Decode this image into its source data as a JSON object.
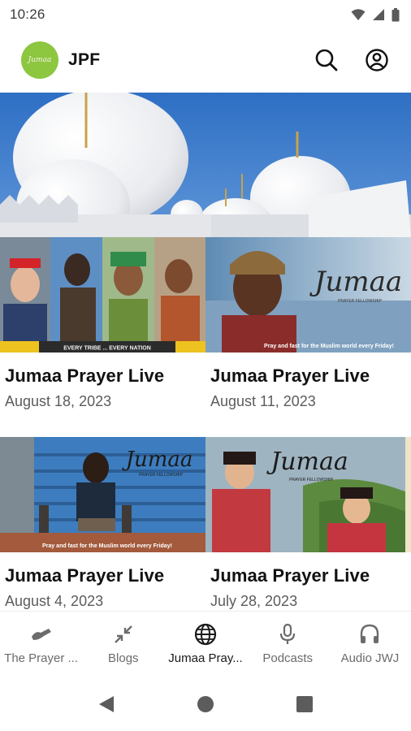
{
  "status_bar": {
    "time": "10:26",
    "icons": [
      "wifi-icon",
      "signal-icon",
      "battery-icon"
    ]
  },
  "app_bar": {
    "logo_text": "Jumaa",
    "title": "JPF",
    "actions": [
      "search-icon",
      "account-icon"
    ],
    "logo_color": "#8dc63f"
  },
  "hero": {
    "image": "mosque-domes-hero"
  },
  "cards": [
    {
      "title": "Jumaa Prayer Live",
      "date": "August 18, 2023",
      "image": "every-tribe-every-nation",
      "caption": "EVERY TRIBE ... EVERY NATION"
    },
    {
      "title": "Jumaa Prayer Live",
      "date": "August 11, 2023",
      "image": "woman-headdress-jumaa",
      "caption": "Pray and fast for the Muslim world every Friday!",
      "overlay": "Jumaa",
      "overlay_sub": "PRAYER FELLOWSHIP"
    },
    {
      "title": "Jumaa Prayer Live",
      "date": "August 4, 2023",
      "image": "boy-blue-wall-jumaa",
      "caption": "Pray and fast for the Muslim world every Friday!",
      "overlay": "Jumaa",
      "overlay_sub": "PRAYER FELLOWSHIP"
    },
    {
      "title": "Jumaa Prayer Live",
      "date": "July 28, 2023",
      "image": "two-women-terraces-jumaa",
      "caption": "",
      "overlay": "Jumaa",
      "overlay_sub": "PRAYER FELLOWSHIP"
    }
  ],
  "bottom_nav": [
    {
      "label": "The Prayer ...",
      "icon": "handshake-icon",
      "active": false
    },
    {
      "label": "Blogs",
      "icon": "arrows-collapse-icon",
      "active": false
    },
    {
      "label": "Jumaa Pray...",
      "icon": "globe-icon",
      "active": true
    },
    {
      "label": "Podcasts",
      "icon": "microphone-icon",
      "active": false
    },
    {
      "label": "Audio JWJ",
      "icon": "headphones-icon",
      "active": false
    }
  ],
  "system_nav": [
    "back-icon",
    "home-icon",
    "recents-icon"
  ]
}
